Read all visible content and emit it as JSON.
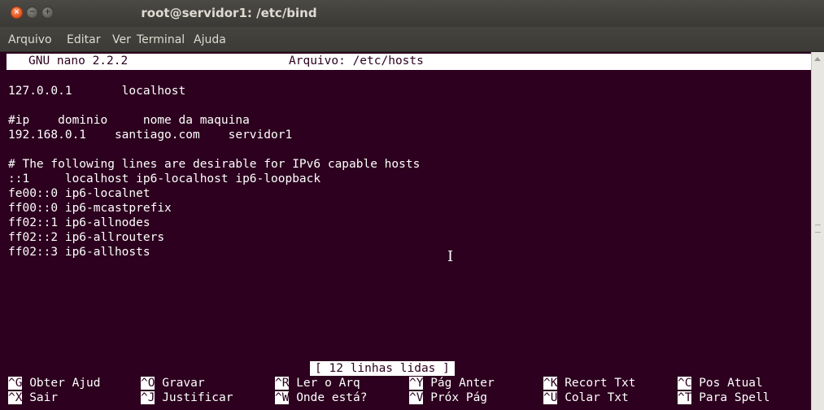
{
  "window": {
    "title": "root@servidor1: /etc/bind",
    "close_icon": "×",
    "minimize_icon": "−",
    "maximize_icon": "+"
  },
  "menubar": [
    "Arquivo",
    "Editar",
    "Ver",
    "Terminal",
    "Ajuda"
  ],
  "nano": {
    "version": "GNU nano 2.2.2",
    "file_label": "Arquivo: /etc/hosts",
    "lines": [
      "127.0.0.1       localhost",
      "",
      "#ip    dominio     nome da maquina",
      "192.168.0.1    santiago.com    servidor1",
      "",
      "# The following lines are desirable for IPv6 capable hosts",
      "::1     localhost ip6-localhost ip6-loopback",
      "fe00::0 ip6-localnet",
      "ff00::0 ip6-mcastprefix",
      "ff02::1 ip6-allnodes",
      "ff02::2 ip6-allrouters",
      "ff02::3 ip6-allhosts"
    ],
    "status": "[ 12 linhas lidas ]",
    "shortcuts_row1": [
      {
        "key": "^G",
        "label": "Obter Ajud"
      },
      {
        "key": "^O",
        "label": "Gravar"
      },
      {
        "key": "^R",
        "label": "Ler o Arq"
      },
      {
        "key": "^Y",
        "label": "Pág Anter"
      },
      {
        "key": "^K",
        "label": "Recort Txt"
      },
      {
        "key": "^C",
        "label": "Pos Atual"
      }
    ],
    "shortcuts_row2": [
      {
        "key": "^X",
        "label": "Sair"
      },
      {
        "key": "^J",
        "label": "Justificar"
      },
      {
        "key": "^W",
        "label": "Onde está?"
      },
      {
        "key": "^V",
        "label": "Próx Pág"
      },
      {
        "key": "^U",
        "label": "Colar Txt"
      },
      {
        "key": "^T",
        "label": "Para Spell"
      }
    ]
  },
  "mouse_cursor": "I",
  "colors": {
    "terminal_bg": "#2c001e",
    "terminal_fg": "#ffffff",
    "title_bg": "#3c3b37",
    "close_button": "#e2511d"
  }
}
